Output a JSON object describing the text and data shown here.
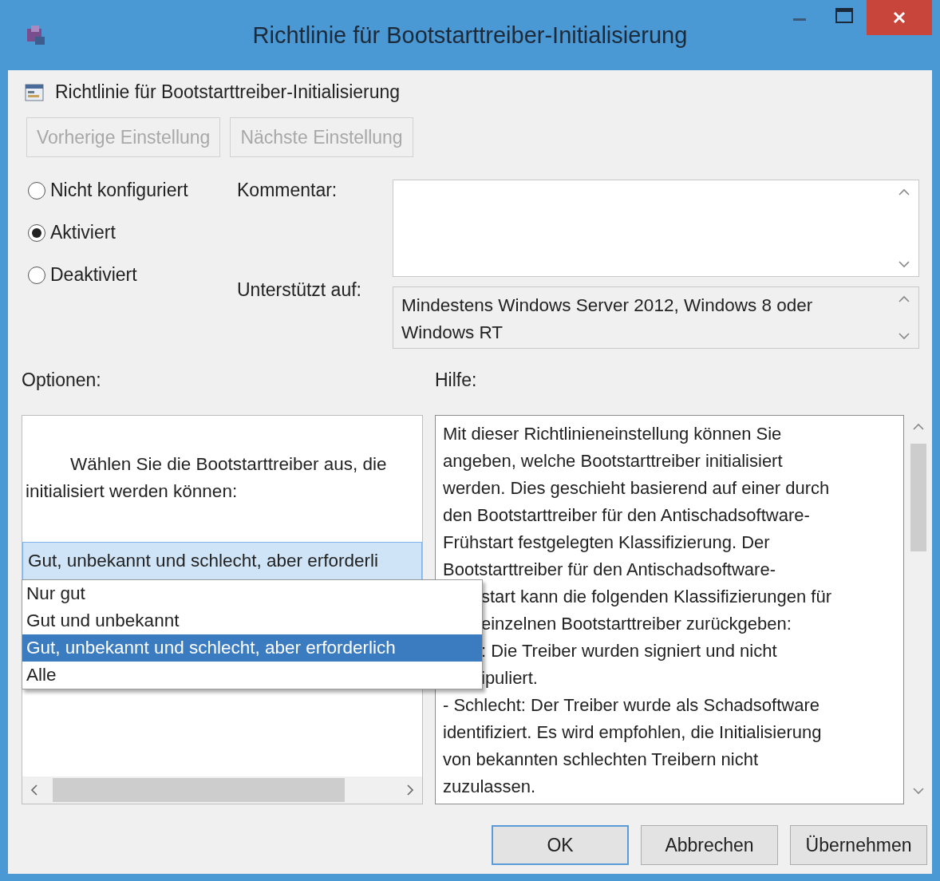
{
  "window": {
    "title": "Richtlinie für Bootstarttreiber-Initialisierung"
  },
  "policy_name": "Richtlinie für Bootstarttreiber-Initialisierung",
  "nav_buttons": [
    {
      "label": "Vorherige Einstellung",
      "disabled": true
    },
    {
      "label": "Nächste Einstellung",
      "disabled": true
    }
  ],
  "state_options": [
    {
      "label": "Nicht konfiguriert",
      "selected": false
    },
    {
      "label": "Aktiviert",
      "selected": true
    },
    {
      "label": "Deaktiviert",
      "selected": false
    }
  ],
  "comment": {
    "label": "Kommentar:"
  },
  "supported": {
    "label": "Unterstützt auf:",
    "value": "Mindestens Windows Server 2012, Windows 8 oder Windows RT"
  },
  "options": {
    "label": "Optionen:",
    "description_lines": [
      "Wählen Sie die Bootstarttreiber aus, die",
      "initialisiert werden können:"
    ],
    "combo_value": "Gut, unbekannt und schlecht, aber erforderli",
    "dropdown_items": [
      {
        "label": "Nur gut",
        "selected": false
      },
      {
        "label": "Gut und unbekannt",
        "selected": false
      },
      {
        "label": "Gut, unbekannt und schlecht, aber erforderlich",
        "selected": true
      },
      {
        "label": "Alle",
        "selected": false
      }
    ]
  },
  "help": {
    "label": "Hilfe:",
    "lines": [
      {
        "text": "Mit dieser Richtlinieneinstellung können Sie",
        "covered": false
      },
      {
        "text": "angeben, welche Bootstarttreiber initialisiert",
        "covered": false
      },
      {
        "text": "werden. Dies geschieht basierend auf einer durch",
        "covered": false
      },
      {
        "text": "den Bootstarttreiber für den Antischadsoftware-",
        "covered": false
      },
      {
        "text": "Frühstart festgelegten Klassifizierung. Der",
        "covered": false
      },
      {
        "text": "Bootstarttreiber für den Antischadsoftware-",
        "covered": false
      },
      {
        "text": "start kann die folgenden Klassifizierungen für",
        "covered": true
      },
      {
        "text": "einzelnen Bootstarttreiber zurückgeben:",
        "covered": true
      },
      {
        "text": ": Die Treiber wurden signiert und nicht",
        "covered": true
      },
      {
        "text": "ipuliert.",
        "covered": true
      },
      {
        "text": "- Schlecht: Der Treiber wurde als Schadsoftware",
        "covered": false
      },
      {
        "text": "identifiziert. Es wird empfohlen, die Initialisierung",
        "covered": false
      },
      {
        "text": "von bekannten schlechten Treibern nicht",
        "covered": false
      },
      {
        "text": "zuzulassen.",
        "covered": false
      }
    ]
  },
  "buttons": [
    {
      "label": "OK",
      "default": true
    },
    {
      "label": "Abbrechen",
      "default": false
    },
    {
      "label": "Übernehmen",
      "default": false
    }
  ]
}
